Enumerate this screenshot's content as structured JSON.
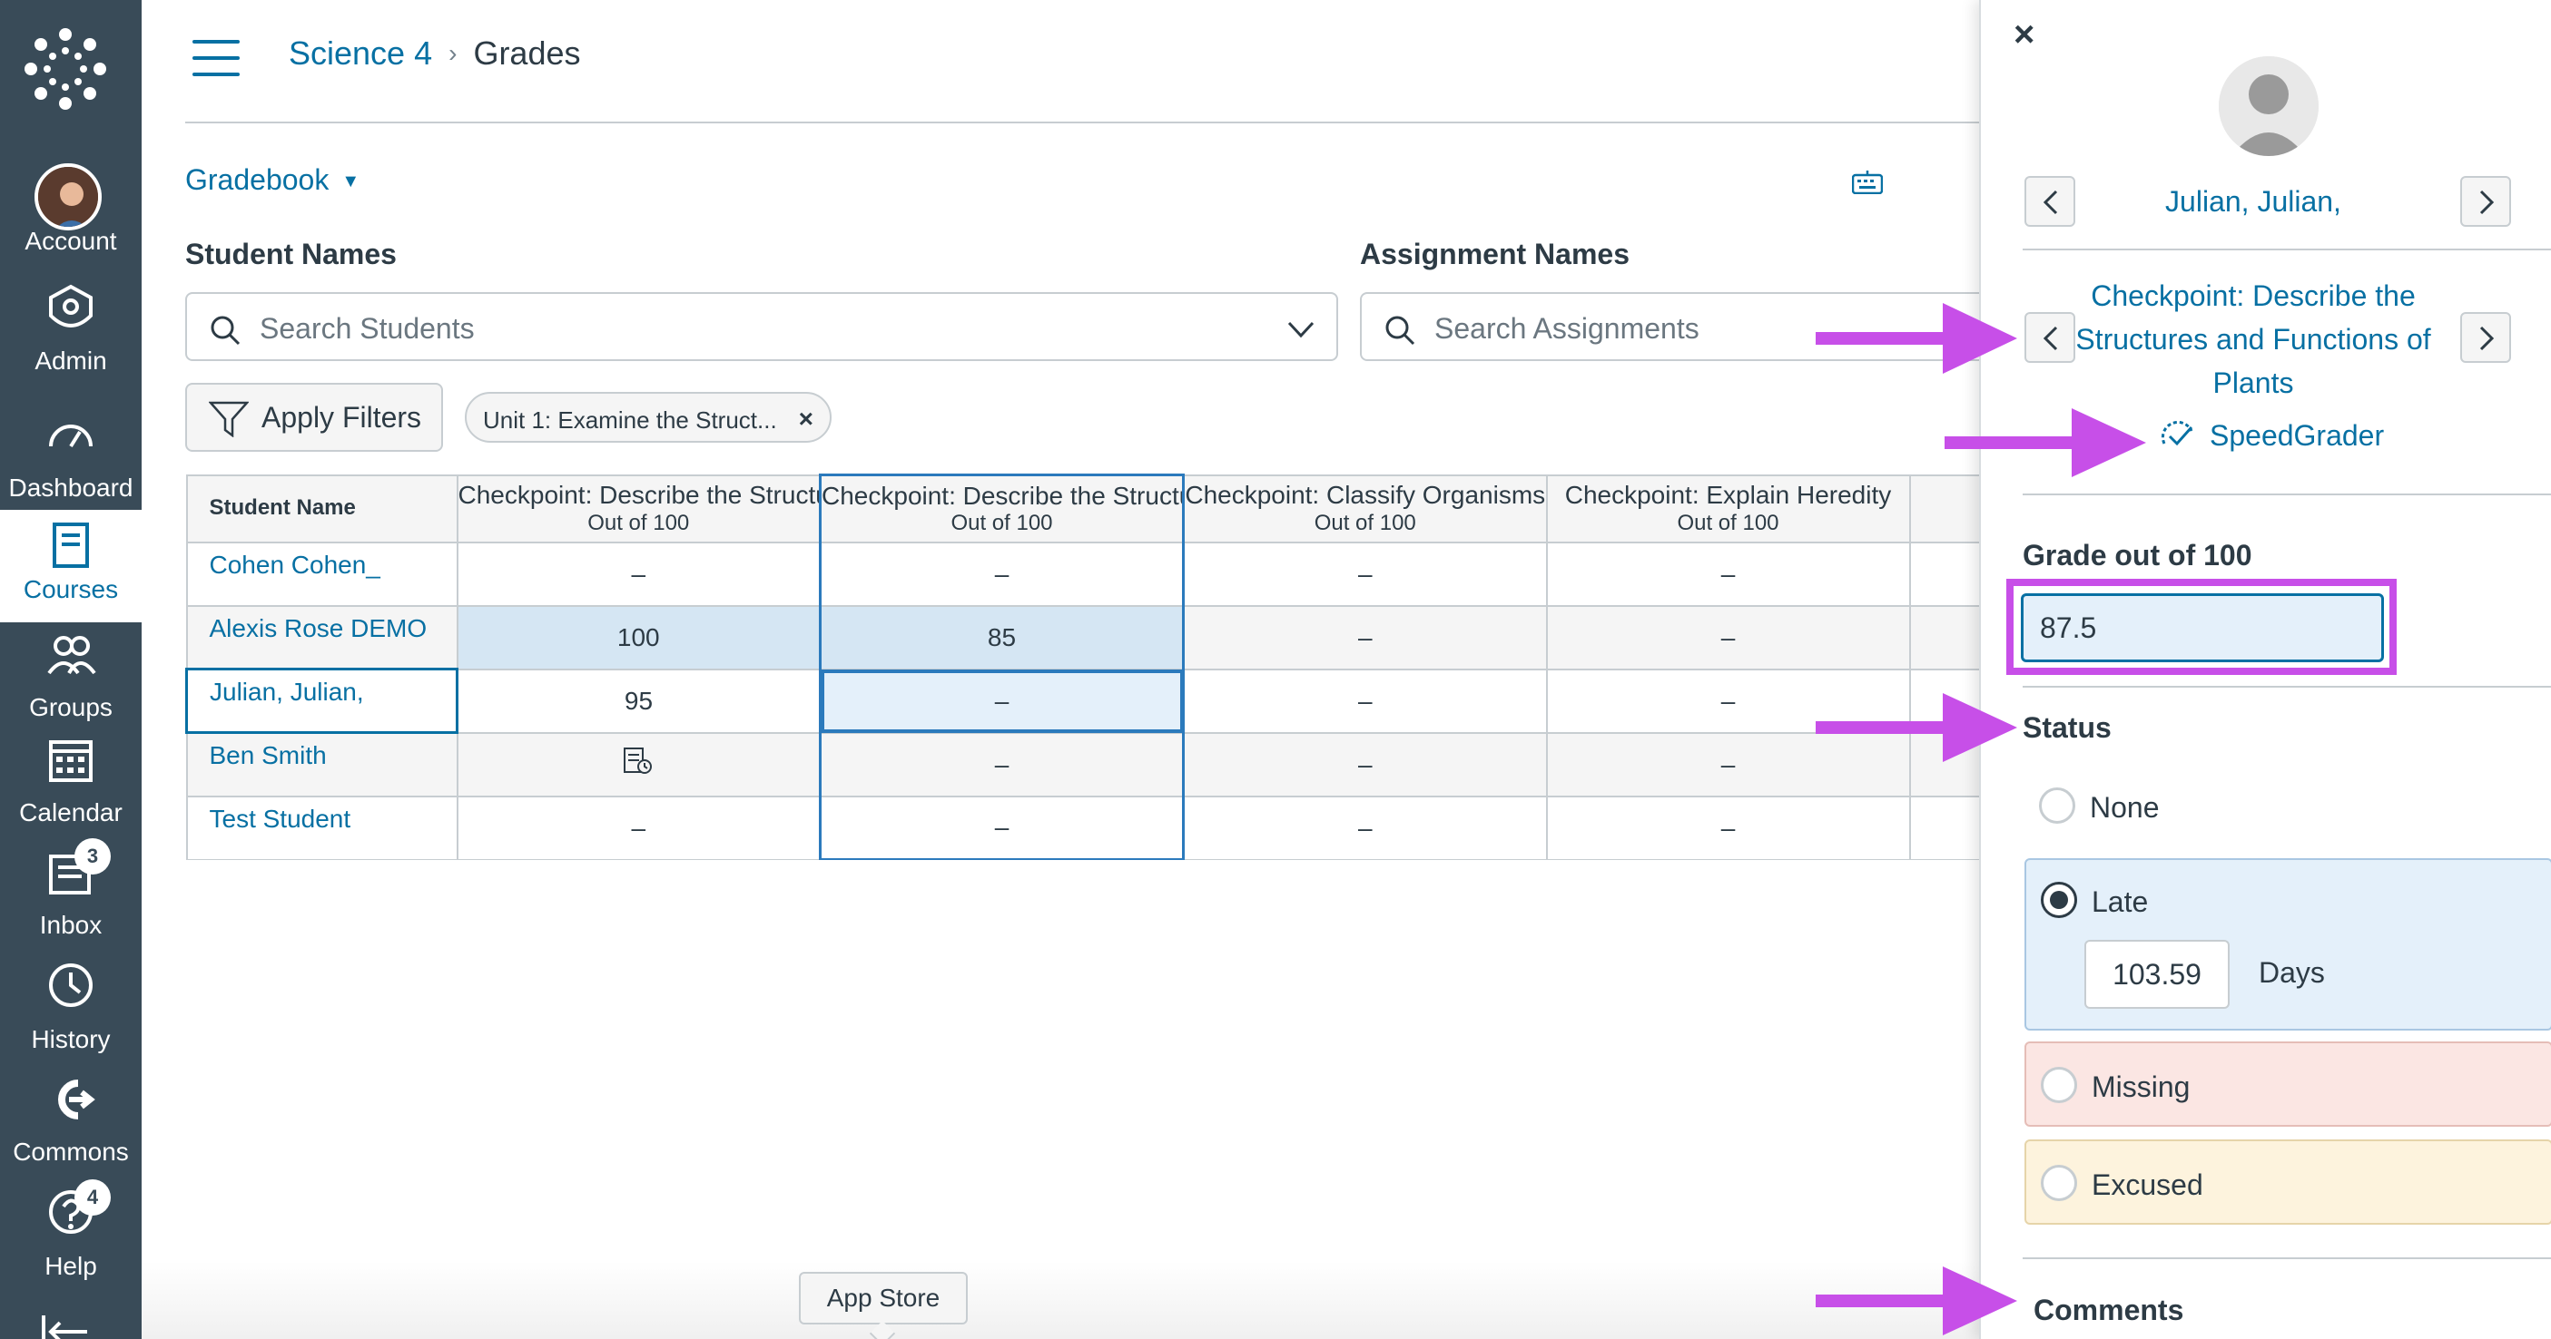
{
  "nav": {
    "items": [
      {
        "label": "Account",
        "icon": "avatar"
      },
      {
        "label": "Admin",
        "icon": "admin-shield-icon"
      },
      {
        "label": "Dashboard",
        "icon": "dashboard-icon"
      },
      {
        "label": "Courses",
        "icon": "courses-book-icon"
      },
      {
        "label": "Groups",
        "icon": "groups-icon"
      },
      {
        "label": "Calendar",
        "icon": "calendar-icon"
      },
      {
        "label": "Inbox",
        "icon": "inbox-icon",
        "badge": "3"
      },
      {
        "label": "History",
        "icon": "history-clock-icon"
      },
      {
        "label": "Commons",
        "icon": "commons-icon"
      },
      {
        "label": "Help",
        "icon": "help-icon",
        "badge": "4"
      }
    ],
    "active": "Courses"
  },
  "breadcrumb": {
    "course": "Science 4",
    "sep": "›",
    "page": "Grades"
  },
  "gradebook_menu": {
    "label": "Gradebook",
    "caret": "▼"
  },
  "filters": {
    "students_label": "Student Names",
    "students_placeholder": "Search Students",
    "assignments_label": "Assignment Names",
    "assignments_placeholder": "Search Assignments",
    "apply_label": "Apply Filters",
    "pill_label": "Unit 1: Examine the Struct...",
    "pill_remove": "×"
  },
  "grid": {
    "name_header": "Student Name",
    "columns": [
      {
        "title": "Checkpoint: Describe the Structures",
        "sub": "Out of 100"
      },
      {
        "title": "Checkpoint: Describe the Structures",
        "sub": "Out of 100"
      },
      {
        "title": "Checkpoint: Classify Organisms",
        "sub": "Out of 100"
      },
      {
        "title": "Checkpoint: Explain Heredity",
        "sub": "Out of 100"
      },
      {
        "title": "",
        "sub": ""
      }
    ],
    "rows": [
      {
        "name": "Cohen Cohen_",
        "cells": [
          "–",
          "–",
          "–",
          "–",
          ""
        ]
      },
      {
        "name": "Alexis Rose DEMO",
        "cells": [
          "100",
          "85",
          "–",
          "–",
          ""
        ]
      },
      {
        "name": "Julian, Julian,",
        "cells": [
          "95",
          "–",
          "–",
          "–",
          ""
        ]
      },
      {
        "name": "Ben Smith",
        "cells": [
          "",
          "–",
          "–",
          "–",
          ""
        ]
      },
      {
        "name": "Test Student",
        "cells": [
          "–",
          "–",
          "–",
          "–",
          ""
        ]
      }
    ]
  },
  "tooltip": "App Store",
  "tray": {
    "close": "×",
    "student": "Julian, Julian,",
    "assignment": "Checkpoint: Describe the Structures and Functions of Plants",
    "speedgrader": "SpeedGrader",
    "grade_label": "Grade out of 100",
    "grade_value": "87.5",
    "status_label": "Status",
    "status": {
      "none": "None",
      "late": "Late",
      "late_days_value": "103.59",
      "days_label": "Days",
      "missing": "Missing",
      "excused": "Excused"
    },
    "selected_status": "Late",
    "comments_label": "Comments"
  },
  "colors": {
    "nav_bg": "#394b58",
    "link": "#0770a3",
    "annotation": "#c74fe8"
  }
}
